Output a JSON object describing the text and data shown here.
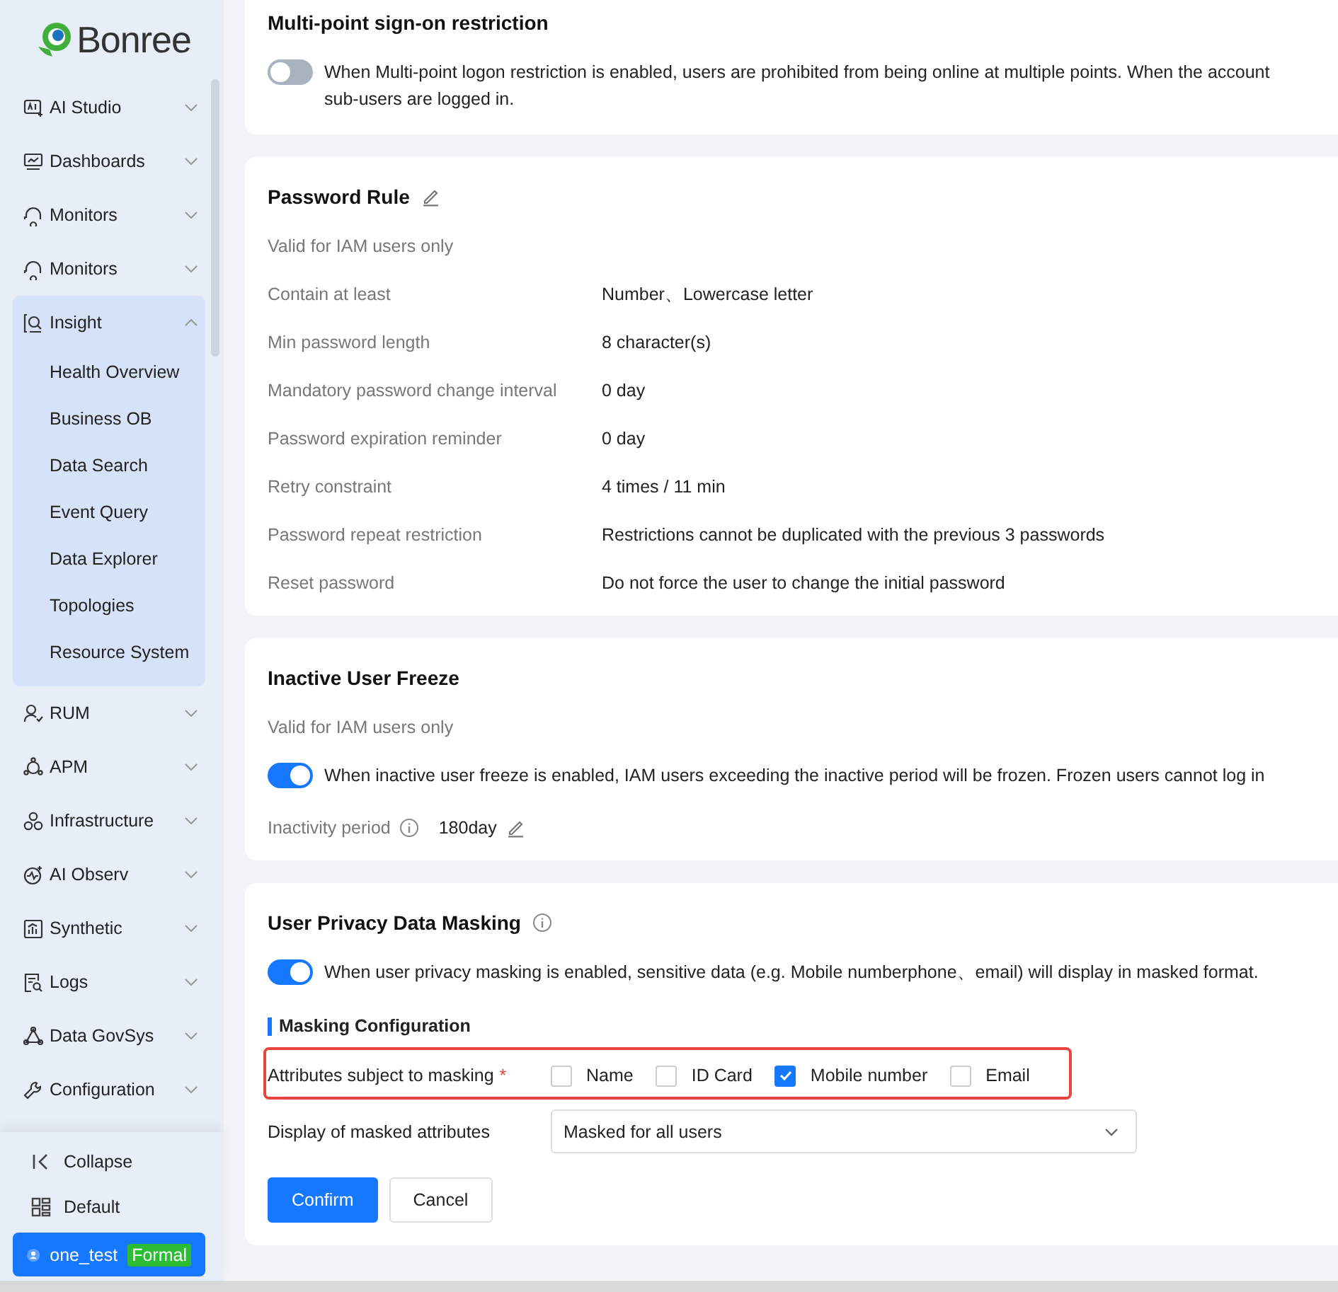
{
  "sidebar": {
    "logo": "Bonree",
    "items": [
      {
        "label": "AI Studio",
        "expanded": false
      },
      {
        "label": "Dashboards",
        "expanded": false
      },
      {
        "label": "Monitors",
        "expanded": false
      },
      {
        "label": "Monitors",
        "expanded": false
      },
      {
        "label": "Insight",
        "expanded": true,
        "children": [
          {
            "label": "Health Overview"
          },
          {
            "label": "Business OB"
          },
          {
            "label": "Data Search"
          },
          {
            "label": "Event Query"
          },
          {
            "label": "Data Explorer"
          },
          {
            "label": "Topologies"
          },
          {
            "label": "Resource System"
          }
        ]
      },
      {
        "label": "RUM",
        "expanded": false
      },
      {
        "label": "APM",
        "expanded": false
      },
      {
        "label": "Infrastructure",
        "expanded": false
      },
      {
        "label": "AI Observ",
        "expanded": false
      },
      {
        "label": "Synthetic",
        "expanded": false
      },
      {
        "label": "Logs",
        "expanded": false
      },
      {
        "label": "Data GovSys",
        "expanded": false
      },
      {
        "label": "Configuration",
        "expanded": false
      }
    ],
    "collapse": "Collapse",
    "workspace": "Default",
    "user": {
      "name": "one_test",
      "badge": "Formal"
    }
  },
  "multi_point": {
    "title": "Multi-point sign-on restriction",
    "toggle_on": false,
    "description_lines": [
      "When Multi-point logon restriction is enabled, users are prohibited from being online at multiple points. When the account",
      "sub-users are logged in."
    ]
  },
  "password_rule": {
    "title": "Password Rule",
    "note": "Valid for IAM users only",
    "rows": [
      {
        "label": "Contain at least",
        "value": "Number、Lowercase letter"
      },
      {
        "label": "Min password length",
        "value": "8 character(s)"
      },
      {
        "label": "Mandatory password change interval",
        "value": "0 day"
      },
      {
        "label": "Password expiration reminder",
        "value": "0 day"
      },
      {
        "label": "Retry constraint",
        "value": "4 times / 11 min"
      },
      {
        "label": "Password repeat restriction",
        "value": "Restrictions cannot be duplicated with the previous 3 passwords"
      },
      {
        "label": "Reset password",
        "value": "Do not force the user to change the initial password"
      }
    ]
  },
  "inactive_freeze": {
    "title": "Inactive User Freeze",
    "note": "Valid for IAM users only",
    "toggle_on": true,
    "description": "When inactive user freeze is enabled, IAM users exceeding the inactive period will be frozen. Frozen users cannot log in",
    "period_label": "Inactivity period",
    "period_value": "180day"
  },
  "masking": {
    "title": "User Privacy Data Masking",
    "toggle_on": true,
    "description": "When user privacy masking is enabled, sensitive data (e.g. Mobile numberphone、email) will display in masked format.",
    "subsection": "Masking Configuration",
    "attributes_label": "Attributes subject to masking",
    "required_mark": "*",
    "options": [
      {
        "label": "Name",
        "checked": false
      },
      {
        "label": "ID Card",
        "checked": false
      },
      {
        "label": "Mobile number",
        "checked": true
      },
      {
        "label": "Email",
        "checked": false
      }
    ],
    "display_label": "Display of masked attributes",
    "display_value": "Masked for all users",
    "buttons": [
      {
        "label": "Confirm",
        "kind": "primary"
      },
      {
        "label": "Cancel",
        "kind": "default"
      }
    ]
  }
}
